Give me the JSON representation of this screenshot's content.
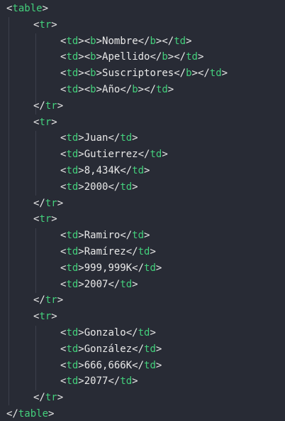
{
  "table_tag": "table",
  "rows": [
    {
      "cells": [
        {
          "bold": true,
          "text": "Nombre"
        },
        {
          "bold": true,
          "text": "Apellido"
        },
        {
          "bold": true,
          "text": "Suscriptores"
        },
        {
          "bold": true,
          "text": "Año"
        }
      ]
    },
    {
      "cells": [
        {
          "bold": false,
          "text": "Juan"
        },
        {
          "bold": false,
          "text": "Gutierrez"
        },
        {
          "bold": false,
          "text": "8,434K"
        },
        {
          "bold": false,
          "text": "2000"
        }
      ]
    },
    {
      "cells": [
        {
          "bold": false,
          "text": "Ramiro"
        },
        {
          "bold": false,
          "text": "Ramírez"
        },
        {
          "bold": false,
          "text": "999,999K"
        },
        {
          "bold": false,
          "text": "2007"
        }
      ]
    },
    {
      "cells": [
        {
          "bold": false,
          "text": "Gonzalo"
        },
        {
          "bold": false,
          "text": "González"
        },
        {
          "bold": false,
          "text": "666,666K"
        },
        {
          "bold": false,
          "text": "2077"
        }
      ]
    }
  ],
  "colors": {
    "background": "#282b35",
    "tag": "#43d07c",
    "text": "#e8e8e8"
  }
}
